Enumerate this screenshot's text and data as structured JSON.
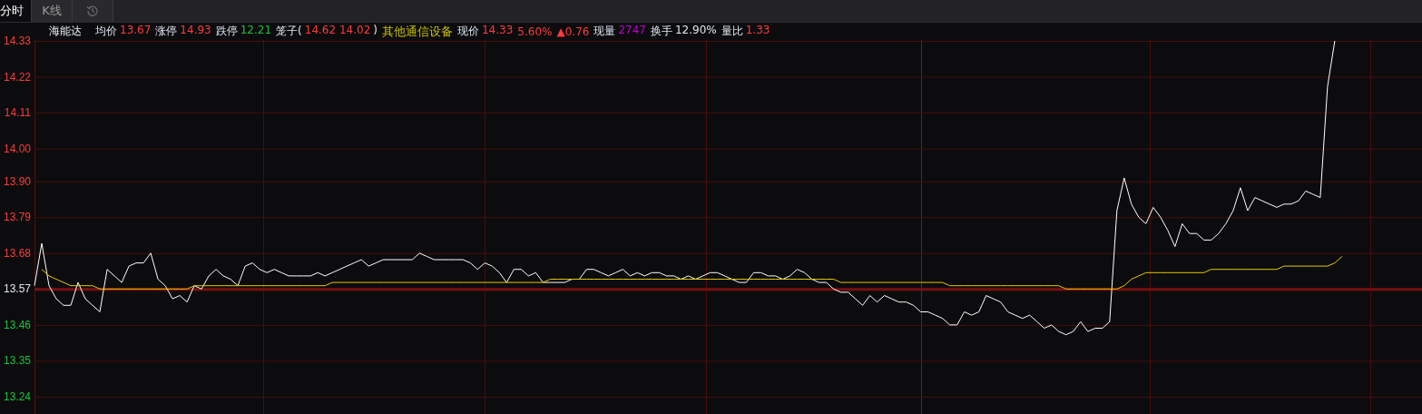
{
  "tabs": [
    {
      "label": "分时",
      "selected": true
    },
    {
      "label": "K线",
      "selected": false
    },
    {
      "kind": "history",
      "selected": false
    }
  ],
  "quote": {
    "name": "海能达",
    "fields": [
      {
        "label": "均价",
        "value": "13.67",
        "color": "#ff3b3b"
      },
      {
        "label": "涨停",
        "value": "14.93",
        "color": "#ff3b3b"
      },
      {
        "label": "跌停",
        "value": "12.21",
        "color": "#19c33c"
      },
      {
        "label": "笼子(",
        "value": "14.62 14.02",
        "suffix": ")",
        "color": "#ff3b3b"
      },
      {
        "kind": "sector",
        "value": "其他通信设备",
        "color": "#c8c000"
      },
      {
        "label": "现价",
        "value": "14.33",
        "color": "#ff3b3b"
      },
      {
        "value": "5.60%",
        "color": "#ff3b3b"
      },
      {
        "value": "▲0.76",
        "color": "#ff3b3b"
      },
      {
        "label": "现量",
        "value": "2747",
        "color": "#c000d0"
      },
      {
        "label": "换手",
        "value": "12.90%",
        "color": "#dde6f0"
      },
      {
        "label": "量比",
        "value": "1.33",
        "color": "#ff3b3b"
      }
    ]
  },
  "chart_data": {
    "type": "line",
    "grid": true,
    "ylim": [
      13.24,
      14.33
    ],
    "yticks": [
      {
        "value": 14.33,
        "label": "14.33"
      },
      {
        "value": 14.22,
        "label": "14.22"
      },
      {
        "value": 14.11,
        "label": "14.11"
      },
      {
        "value": 14.0,
        "label": "14.00"
      },
      {
        "value": 13.9,
        "label": "13.90"
      },
      {
        "value": 13.79,
        "label": "13.79"
      },
      {
        "value": 13.68,
        "label": "13.68"
      },
      {
        "value": 13.57,
        "label": "13.57"
      },
      {
        "value": 13.46,
        "label": "13.46"
      },
      {
        "value": 13.35,
        "label": "13.35"
      },
      {
        "value": 13.24,
        "label": "13.24"
      }
    ],
    "ref_lines": [
      {
        "axis": "y",
        "value": 13.57
      }
    ],
    "series": [
      {
        "color": "#ffffff",
        "values": [
          13.58,
          13.71,
          13.58,
          13.54,
          13.52,
          13.52,
          13.59,
          13.54,
          13.52,
          13.5,
          13.63,
          13.61,
          13.59,
          13.64,
          13.65,
          13.65,
          13.68,
          13.6,
          13.58,
          13.54,
          13.55,
          13.53,
          13.58,
          13.57,
          13.61,
          13.63,
          13.61,
          13.6,
          13.58,
          13.64,
          13.65,
          13.63,
          13.62,
          13.63,
          13.62,
          13.61,
          13.61,
          13.61,
          13.61,
          13.62,
          13.61,
          13.62,
          13.63,
          13.64,
          13.65,
          13.66,
          13.64,
          13.65,
          13.66,
          13.66,
          13.66,
          13.66,
          13.66,
          13.68,
          13.67,
          13.66,
          13.66,
          13.66,
          13.66,
          13.66,
          13.65,
          13.63,
          13.65,
          13.64,
          13.62,
          13.59,
          13.63,
          13.63,
          13.61,
          13.62,
          13.59,
          13.59,
          13.59,
          13.59,
          13.6,
          13.6,
          13.63,
          13.63,
          13.62,
          13.61,
          13.62,
          13.63,
          13.61,
          13.62,
          13.61,
          13.62,
          13.62,
          13.61,
          13.61,
          13.6,
          13.61,
          13.6,
          13.61,
          13.62,
          13.62,
          13.61,
          13.6,
          13.59,
          13.59,
          13.62,
          13.62,
          13.61,
          13.61,
          13.6,
          13.61,
          13.63,
          13.62,
          13.6,
          13.59,
          13.59,
          13.57,
          13.56,
          13.56,
          13.54,
          13.52,
          13.55,
          13.53,
          13.55,
          13.54,
          13.53,
          13.53,
          13.52,
          13.5,
          13.5,
          13.49,
          13.48,
          13.46,
          13.46,
          13.5,
          13.49,
          13.5,
          13.55,
          13.54,
          13.53,
          13.5,
          13.49,
          13.48,
          13.49,
          13.47,
          13.45,
          13.46,
          13.44,
          13.43,
          13.44,
          13.47,
          13.44,
          13.45,
          13.45,
          13.47,
          13.81,
          13.91,
          13.83,
          13.79,
          13.77,
          13.82,
          13.79,
          13.75,
          13.7,
          13.77,
          13.74,
          13.74,
          13.72,
          13.72,
          13.74,
          13.77,
          13.81,
          13.88,
          13.81,
          13.85,
          13.84,
          13.83,
          13.82,
          13.83,
          13.83,
          13.84,
          13.87,
          13.86,
          13.85,
          14.19,
          14.33
        ]
      },
      {
        "color": "#e6c800",
        "values": [
          null,
          13.63,
          13.61,
          13.6,
          13.59,
          13.58,
          13.58,
          13.58,
          13.58,
          13.57,
          13.57,
          13.57,
          13.57,
          13.57,
          13.57,
          13.57,
          13.57,
          13.57,
          13.57,
          13.57,
          13.57,
          13.57,
          13.58,
          13.58,
          13.58,
          13.58,
          13.58,
          13.58,
          13.58,
          13.58,
          13.58,
          13.58,
          13.58,
          13.58,
          13.58,
          13.58,
          13.58,
          13.58,
          13.58,
          13.58,
          13.58,
          13.59,
          13.59,
          13.59,
          13.59,
          13.59,
          13.59,
          13.59,
          13.59,
          13.59,
          13.59,
          13.59,
          13.59,
          13.59,
          13.59,
          13.59,
          13.59,
          13.59,
          13.59,
          13.59,
          13.59,
          13.59,
          13.59,
          13.59,
          13.59,
          13.59,
          13.59,
          13.59,
          13.59,
          13.59,
          13.59,
          13.6,
          13.6,
          13.6,
          13.6,
          13.6,
          13.6,
          13.6,
          13.6,
          13.6,
          13.6,
          13.6,
          13.6,
          13.6,
          13.6,
          13.6,
          13.6,
          13.6,
          13.6,
          13.6,
          13.6,
          13.6,
          13.6,
          13.6,
          13.6,
          13.6,
          13.6,
          13.6,
          13.6,
          13.6,
          13.6,
          13.6,
          13.6,
          13.6,
          13.6,
          13.6,
          13.6,
          13.6,
          13.6,
          13.6,
          13.6,
          13.59,
          13.59,
          13.59,
          13.59,
          13.59,
          13.59,
          13.59,
          13.59,
          13.59,
          13.59,
          13.59,
          13.59,
          13.59,
          13.59,
          13.59,
          13.58,
          13.58,
          13.58,
          13.58,
          13.58,
          13.58,
          13.58,
          13.58,
          13.58,
          13.58,
          13.58,
          13.58,
          13.58,
          13.58,
          13.58,
          13.58,
          13.57,
          13.57,
          13.57,
          13.57,
          13.57,
          13.57,
          13.57,
          13.57,
          13.58,
          13.6,
          13.61,
          13.62,
          13.62,
          13.62,
          13.62,
          13.62,
          13.62,
          13.62,
          13.62,
          13.62,
          13.63,
          13.63,
          13.63,
          13.63,
          13.63,
          13.63,
          13.63,
          13.63,
          13.63,
          13.63,
          13.64,
          13.64,
          13.64,
          13.64,
          13.64,
          13.64,
          13.64,
          13.65,
          13.67
        ]
      }
    ]
  }
}
